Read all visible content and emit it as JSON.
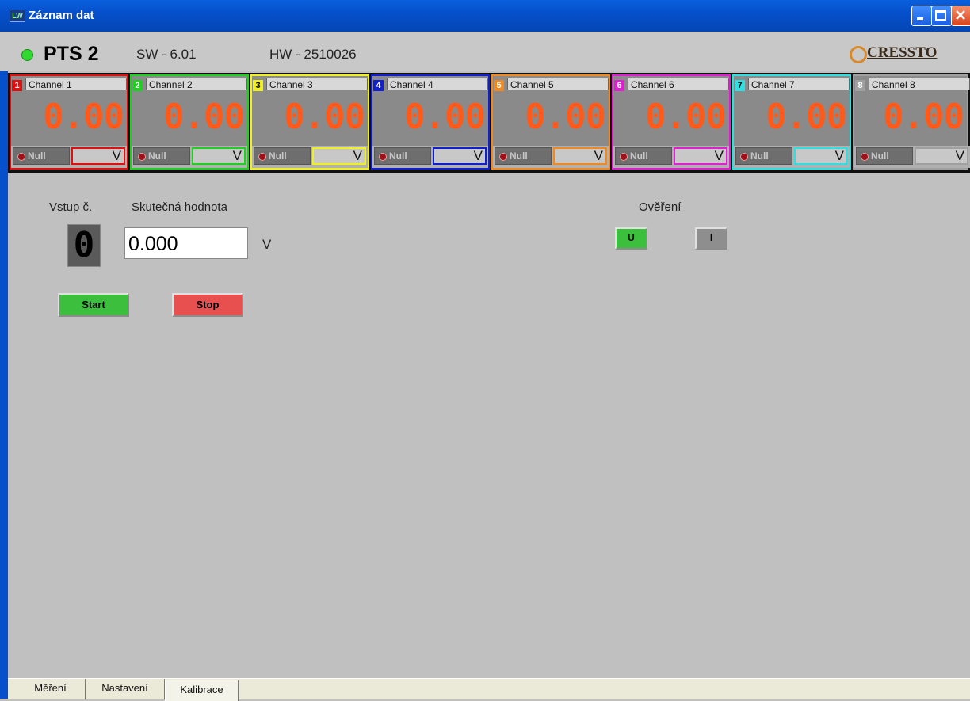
{
  "window": {
    "title": "Záznam dat",
    "app_icon": "LW"
  },
  "header": {
    "device": "PTS 2",
    "sw": "SW - 6.01",
    "hw": "HW - 2510026",
    "brand": "CRESSTO"
  },
  "channels": [
    {
      "num": "1",
      "name": "Channel 1",
      "value": "0.00",
      "null_label": "Null",
      "unit": "V",
      "color": "#e01010"
    },
    {
      "num": "2",
      "name": "Channel 2",
      "value": "0.00",
      "null_label": "Null",
      "unit": "V",
      "color": "#20d020"
    },
    {
      "num": "3",
      "name": "Channel 3",
      "value": "0.00",
      "null_label": "Null",
      "unit": "V",
      "color": "#f0f020"
    },
    {
      "num": "4",
      "name": "Channel 4",
      "value": "0.00",
      "null_label": "Null",
      "unit": "V",
      "color": "#1020d0"
    },
    {
      "num": "5",
      "name": "Channel 5",
      "value": "0.00",
      "null_label": "Null",
      "unit": "V",
      "color": "#f08a20"
    },
    {
      "num": "6",
      "name": "Channel 6",
      "value": "0.00",
      "null_label": "Null",
      "unit": "V",
      "color": "#e020d0"
    },
    {
      "num": "7",
      "name": "Channel 7",
      "value": "0.00",
      "null_label": "Null",
      "unit": "V",
      "color": "#30e0e0"
    },
    {
      "num": "8",
      "name": "Channel 8",
      "value": "0.00",
      "null_label": "Null",
      "unit": "V",
      "color": "#a0a0a0"
    }
  ],
  "calibration": {
    "input_label": "Vstup č.",
    "input_value": "0",
    "actual_label": "Skutečná hodnota",
    "actual_value": "0.000",
    "actual_unit": "V",
    "verify_label": "Ověření",
    "u_button": "U",
    "i_button": "I",
    "start_button": "Start",
    "stop_button": "Stop"
  },
  "tabs": [
    "Měření",
    "Nastavení",
    "Kalibrace"
  ],
  "active_tab": "Kalibrace"
}
